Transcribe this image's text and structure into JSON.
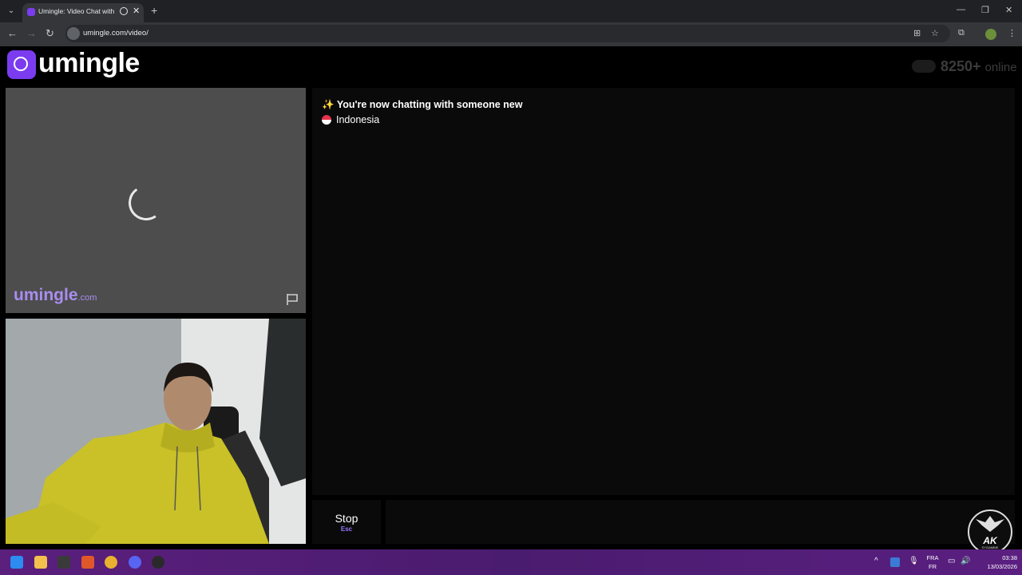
{
  "browser": {
    "tab_title": "Umingle: Video Chat with S",
    "tab_close": "✕",
    "new_tab": "+",
    "url": "umingle.com/video/",
    "minimize": "—",
    "restore": "❐",
    "close": "✕"
  },
  "app": {
    "logo_text": "umingle",
    "online_count": "8250+",
    "online_word": "online",
    "watermark": "umingle",
    "watermark_tld": ".com"
  },
  "chat": {
    "status_icon": "✨",
    "status_message": "You're now chatting with someone new",
    "country": "Indonesia",
    "country_flag_colors": [
      "#e8324c",
      "#ffffff"
    ],
    "stop_label": "Stop",
    "stop_shortcut": "Esc"
  },
  "badge": {
    "text": "AK",
    "subtext": "SYGAMBIE"
  },
  "taskbar": {
    "lang_top": "FRA",
    "lang_bottom": "FR",
    "time": "03:38",
    "date": "13/03/2026"
  },
  "colors": {
    "brand": "#7b3cf0",
    "stop_key": "#9b78ff",
    "taskbar": "#4a1c6f"
  }
}
